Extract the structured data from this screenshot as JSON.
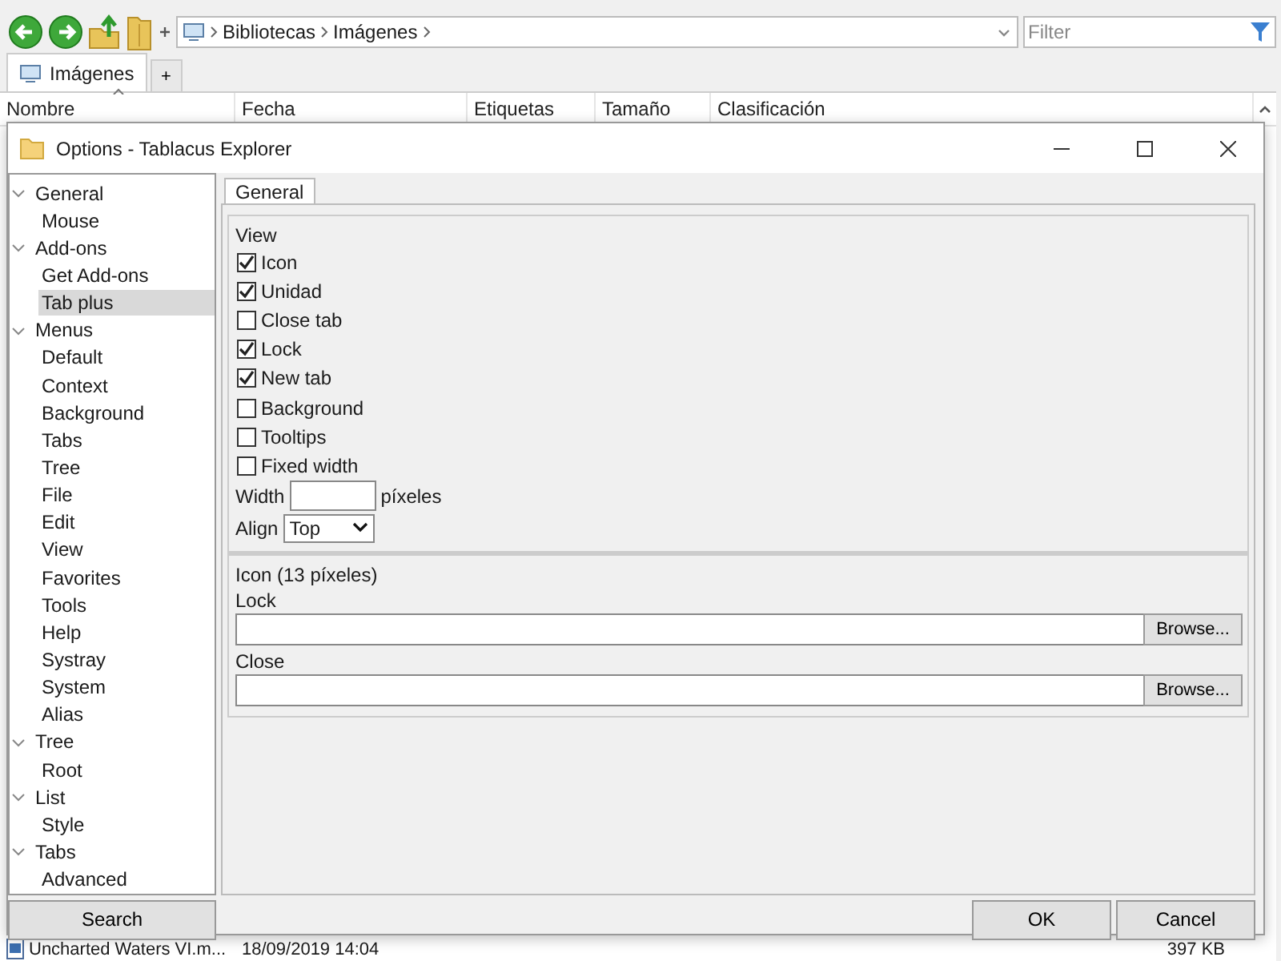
{
  "explorer": {
    "address": {
      "crumbs": [
        "Bibliotecas",
        "Imágenes"
      ]
    },
    "filter": {
      "placeholder": "Filter"
    },
    "tabs": [
      {
        "label": "Imágenes",
        "selected": true
      }
    ],
    "new_tab_label": "+",
    "columns": [
      "Nombre",
      "Fecha",
      "Etiquetas",
      "Tamaño",
      "Clasificación"
    ],
    "rows": [
      {
        "name": "Uncharted Waters VI.m...",
        "date": "18/09/2019 14:04",
        "size": "397 KB"
      }
    ]
  },
  "dialog": {
    "title": "Options - Tablacus Explorer",
    "tree": [
      {
        "label": "General",
        "expanded": true,
        "selected": false,
        "children": [
          {
            "label": "Mouse",
            "selected": false
          }
        ]
      },
      {
        "label": "Add-ons",
        "expanded": true,
        "selected": false,
        "children": [
          {
            "label": "Get Add-ons",
            "selected": false
          },
          {
            "label": "Tab plus",
            "selected": true
          }
        ]
      },
      {
        "label": "Menus",
        "expanded": true,
        "selected": false,
        "children": [
          {
            "label": "Default",
            "selected": false
          },
          {
            "label": "Context",
            "selected": false
          },
          {
            "label": "Background",
            "selected": false
          },
          {
            "label": "Tabs",
            "selected": false
          },
          {
            "label": "Tree",
            "selected": false
          },
          {
            "label": "File",
            "selected": false
          },
          {
            "label": "Edit",
            "selected": false
          },
          {
            "label": "View",
            "selected": false
          },
          {
            "label": "Favorites",
            "selected": false
          },
          {
            "label": "Tools",
            "selected": false
          },
          {
            "label": "Help",
            "selected": false
          },
          {
            "label": "Systray",
            "selected": false
          },
          {
            "label": "System",
            "selected": false
          },
          {
            "label": "Alias",
            "selected": false
          }
        ]
      },
      {
        "label": "Tree",
        "expanded": true,
        "selected": false,
        "children": [
          {
            "label": "Root",
            "selected": false
          }
        ]
      },
      {
        "label": "List",
        "expanded": true,
        "selected": false,
        "children": [
          {
            "label": "Style",
            "selected": false
          }
        ]
      },
      {
        "label": "Tabs",
        "expanded": true,
        "selected": false,
        "children": [
          {
            "label": "Advanced",
            "selected": false
          }
        ]
      }
    ],
    "search_button": "Search",
    "tabs": [
      {
        "label": "General",
        "selected": true
      }
    ],
    "view": {
      "title": "View",
      "options": [
        {
          "label": "Icon",
          "checked": true
        },
        {
          "label": "Unidad",
          "checked": true
        },
        {
          "label": "Close tab",
          "checked": false
        },
        {
          "label": "Lock",
          "checked": true
        },
        {
          "label": "New tab",
          "checked": true
        },
        {
          "label": "Background",
          "checked": false
        },
        {
          "label": "Tooltips",
          "checked": false
        },
        {
          "label": "Fixed width",
          "checked": false
        }
      ],
      "width": {
        "label": "Width",
        "unit": "píxeles"
      },
      "align": {
        "label": "Align",
        "value": "Top"
      }
    },
    "icon_section": {
      "title": "Icon (13 píxeles)",
      "fields": [
        {
          "label": "Lock",
          "button": "Browse..."
        },
        {
          "label": "Close",
          "button": "Browse..."
        }
      ]
    },
    "buttons": [
      "OK",
      "Cancel"
    ]
  }
}
